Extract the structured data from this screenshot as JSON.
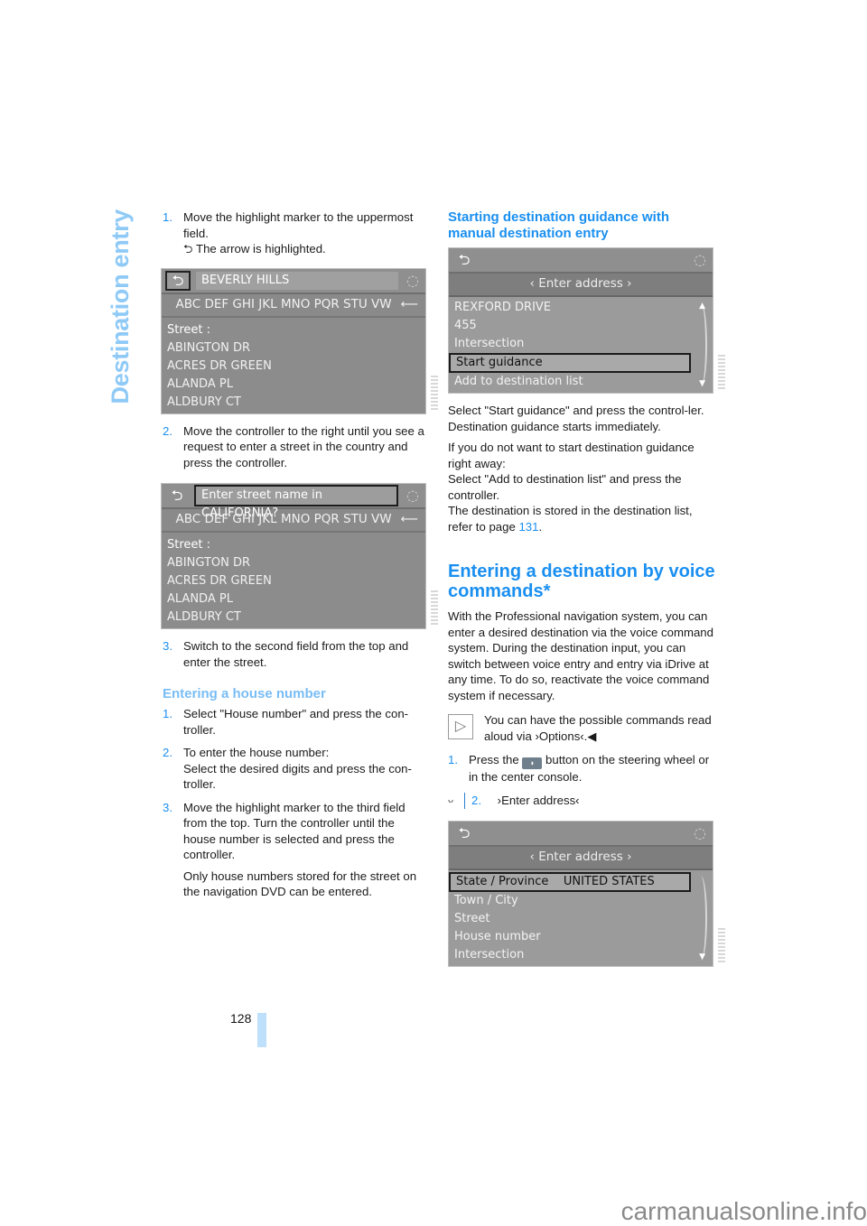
{
  "side_title": "Destination entry",
  "page_number": "128",
  "footer": "carmanualsonline.info",
  "left": {
    "steps_a": [
      {
        "num": "1.",
        "text": "Move the highlight marker to the uppermost field.",
        "sub": "The arrow is highlighted."
      },
      {
        "num": "2.",
        "text": "Move the controller to the right until you see a request to enter a street in the country and press the controller."
      },
      {
        "num": "3.",
        "text": "Switch to the second field from the top and enter the street."
      }
    ],
    "screen1": {
      "head": "BEVERLY HILLS",
      "alphabet": "ABC DEF GHI JKL MNO PQR STU VW",
      "list": [
        "Street :",
        "ABINGTON DR",
        "ACRES DR GREEN",
        "ALANDA PL",
        "ALDBURY CT"
      ]
    },
    "screen2": {
      "head": "Enter street name in CALIFORNIA?",
      "alphabet": "ABC DEF GHI JKL MNO PQR STU VW",
      "list": [
        "Street :",
        "ABINGTON DR",
        "ACRES DR GREEN",
        "ALANDA PL",
        "ALDBURY CT"
      ]
    },
    "house_heading": "Entering a house number",
    "house_steps": [
      {
        "num": "1.",
        "text": "Select \"House number\" and press the con-troller."
      },
      {
        "num": "2.",
        "text": "To enter the house number:",
        "sub": "Select the desired digits and press the con-troller."
      },
      {
        "num": "3.",
        "text": "Move the highlight marker to the third field from the top. Turn the controller until the house number is selected and press the controller.",
        "sub": "Only house numbers stored for the street on the navigation DVD can be entered."
      }
    ]
  },
  "right": {
    "heading": "Starting destination guidance with manual destination entry",
    "screen3": {
      "tab": "Enter address",
      "list": [
        "REXFORD DRIVE",
        "455",
        "Intersection",
        "Start guidance",
        "Add to destination list"
      ],
      "selected": "Start guidance"
    },
    "p1": "Select \"Start guidance\" and press the control-ler.",
    "p2": "Destination guidance starts immediately.",
    "p3": "If you do not want to start destination guidance right away:",
    "p4": "Select \"Add to destination list\" and press the controller.",
    "p5_pre": "The destination is stored in the destination list, refer to page ",
    "p5_link": "131",
    "p5_post": ".",
    "big_heading": "Entering a destination by voice commands*",
    "voice_para": "With the Professional navigation system, you can enter a desired destination via the voice command system. During the destination input, you can switch between voice entry and entry via iDrive at any time. To do so, reactivate the voice command system if necessary.",
    "note": "You can have the possible commands read aloud via ›Options‹.◀",
    "voice_steps": [
      {
        "num": "1.",
        "pre": "Press the ",
        "post": " button on the steering wheel or in the center console."
      },
      {
        "num": "2.",
        "text": "›Enter address‹"
      }
    ],
    "screen4": {
      "tab": "Enter address",
      "list": [
        "State / Province    UNITED STATES",
        "Town / City",
        "Street",
        "House number",
        "Intersection"
      ],
      "selected": "State / Province    UNITED STATES"
    }
  },
  "icons": {
    "back": "⮌",
    "controller": "◌",
    "enter": "⟵",
    "tab_left": "‹",
    "tab_right": "›",
    "up": "▲",
    "down": "▼",
    "note": "▷",
    "voice": "Ш"
  }
}
